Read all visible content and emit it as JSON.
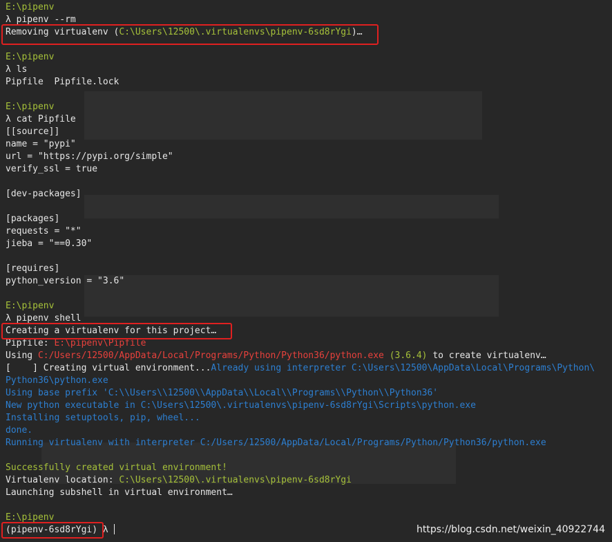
{
  "prompt_dir": "E:\\pipenv",
  "lambda": "λ",
  "cmd_rm": "pipenv --rm",
  "removing_prefix": "Removing virtualenv (",
  "removing_path": "C:\\Users\\12500\\.virtualenvs\\pipenv-6sd8rYgi",
  "removing_suffix": ")…",
  "cmd_ls": "ls",
  "ls_output": "Pipfile  Pipfile.lock",
  "cmd_cat": "cat Pipfile",
  "pipfile_lines": [
    "[[source]]",
    "name = \"pypi\"",
    "url = \"https://pypi.org/simple\"",
    "verify_ssl = true",
    "",
    "[dev-packages]",
    "",
    "[packages]",
    "requests = \"*\"",
    "jieba = \"==0.30\"",
    "",
    "[requires]",
    "python_version = \"3.6\""
  ],
  "cmd_shell": "pipenv shell",
  "creating_msg": "Creating a virtualenv for this project…",
  "pipfile_label": "Pipfile: ",
  "pipfile_path": "E:\\pipenv\\Pipfile",
  "using_label": "Using ",
  "python_exe_path": "C:/Users/12500/AppData/Local/Programs/Python/Python36/python.exe",
  "python_version_shown": "(3.6.4)",
  "to_create_msg": " to create virtualenv…",
  "progress_prefix": "[    ] Creating virtual environment...",
  "already_using": "Already using interpreter C:\\Users\\12500\\AppData\\Local\\Programs\\Python\\",
  "already_using_cont": "Python36\\python.exe",
  "base_prefix": "Using base prefix 'C:\\\\Users\\\\12500\\\\AppData\\\\Local\\\\Programs\\\\Python\\\\Python36'",
  "new_python": "New python executable in C:\\Users\\12500\\.virtualenvs\\pipenv-6sd8rYgi\\Scripts\\python.exe",
  "installing": "Installing setuptools, pip, wheel...",
  "done": "done.",
  "running_virtualenv": "Running virtualenv with interpreter C:/Users/12500/AppData/Local/Programs/Python/Python36/python.exe",
  "success_msg": "Successfully created virtual environment!",
  "venv_location_label": "Virtualenv location: ",
  "venv_location_path": "C:\\Users\\12500\\.virtualenvs\\pipenv-6sd8rYgi",
  "launching_msg": "Launching subshell in virtual environment…",
  "venv_prompt": "(pipenv-6sd8rYgi)",
  "watermark": "https://blog.csdn.net/weixin_40922744",
  "colors": {
    "background": "#272727",
    "foreground": "#e8e8e8",
    "green": "#a6c13a",
    "red": "#e8413c",
    "blue": "#2d7fd1",
    "highlight_box": "#e02020"
  }
}
